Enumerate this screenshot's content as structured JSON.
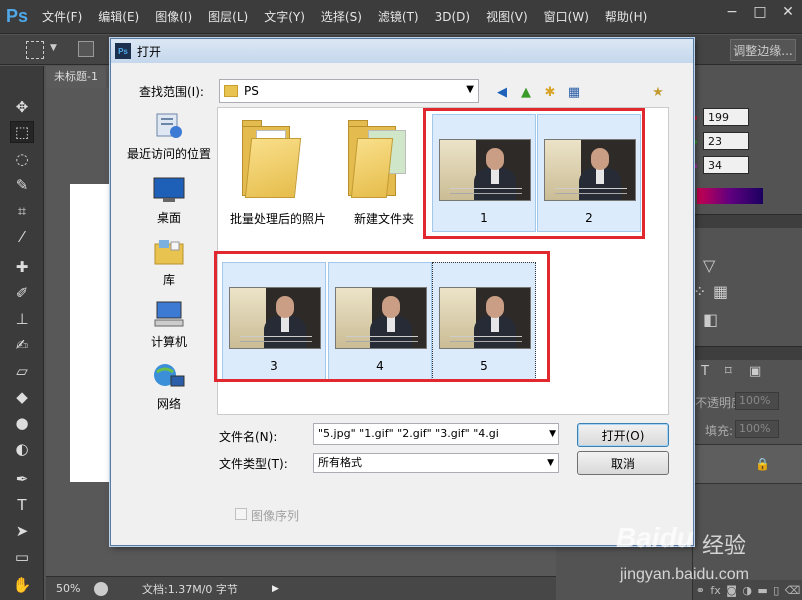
{
  "app": {
    "logo": "Ps",
    "menus": [
      "文件(F)",
      "编辑(E)",
      "图像(I)",
      "图层(L)",
      "文字(Y)",
      "选择(S)",
      "滤镜(T)",
      "3D(D)",
      "视图(V)",
      "窗口(W)",
      "帮助(H)"
    ],
    "window_controls": [
      "−",
      "□",
      "✕"
    ]
  },
  "options_bar": {
    "refine_edge_label": "调整边缘..."
  },
  "document": {
    "tab_title": "未标题-1",
    "zoom": "50%",
    "doc_info": "文档:1.37M/0 字节"
  },
  "right_panel": {
    "r_value": "199",
    "g_value": "23",
    "b_value": "34",
    "opacity_label": "不透明度:",
    "opacity_value": "100%",
    "fill_label": "填充:",
    "fill_value": "100%"
  },
  "dialog": {
    "title": "打开",
    "look_in_label": "查找范围(I):",
    "look_in_value": "PS",
    "places": [
      {
        "label": "最近访问的位置",
        "icon": "recent-places-icon"
      },
      {
        "label": "桌面",
        "icon": "desktop-icon"
      },
      {
        "label": "库",
        "icon": "libraries-icon"
      },
      {
        "label": "计算机",
        "icon": "computer-icon"
      },
      {
        "label": "网络",
        "icon": "network-icon"
      }
    ],
    "files": [
      {
        "name": "批量处理后的照片",
        "kind": "folder"
      },
      {
        "name": "新建文件夹",
        "kind": "folder"
      },
      {
        "name": "1",
        "kind": "image"
      },
      {
        "name": "2",
        "kind": "image"
      },
      {
        "name": "3",
        "kind": "image"
      },
      {
        "name": "4",
        "kind": "image"
      },
      {
        "name": "5",
        "kind": "image"
      }
    ],
    "filename_label": "文件名(N):",
    "filename_value": "\"5.jpg\" \"1.gif\" \"2.gif\" \"3.gif\" \"4.gi",
    "filetype_label": "文件类型(T):",
    "filetype_value": "所有格式",
    "open_button": "打开(O)",
    "cancel_button": "取消",
    "image_sequence_label": "图像序列"
  },
  "watermark": {
    "brand": "Baidu",
    "cn": "经验",
    "url": "jingyan.baidu.com"
  },
  "colors": {
    "highlight_box": "#e0282e",
    "selection_fill": "#dcebfc",
    "ps_chrome": "#535353"
  }
}
